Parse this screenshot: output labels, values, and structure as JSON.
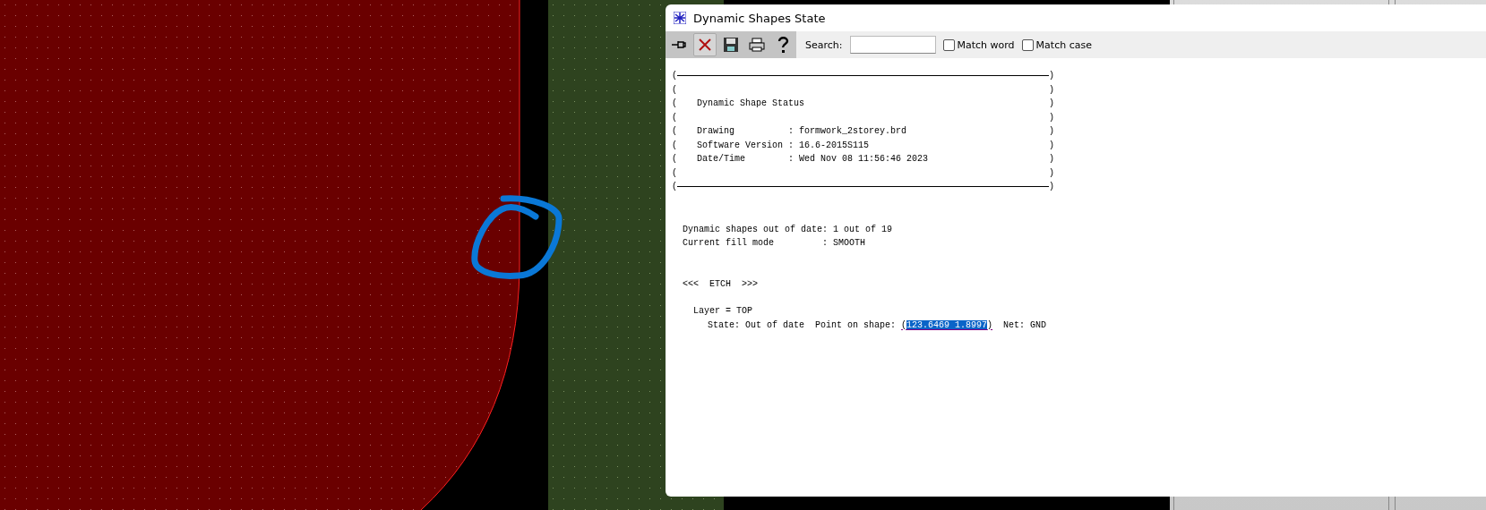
{
  "window": {
    "title": "Dynamic Shapes State"
  },
  "toolbar": {
    "search_label": "Search:",
    "options": [
      {
        "label": "Match word",
        "checked": false
      },
      {
        "label": "Match case",
        "checked": false
      }
    ]
  },
  "report": {
    "box": [
      {
        "kind": "rule",
        "left": "(",
        "right": ")"
      },
      {
        "kind": "text",
        "left": "(",
        "right": ")"
      },
      {
        "kind": "text",
        "left": "(",
        "text": "Dynamic Shape Status",
        "right": ")"
      },
      {
        "kind": "text",
        "left": "(",
        "right": ")"
      },
      {
        "kind": "text",
        "left": "(",
        "text": "Drawing          : formwork_2storey.brd",
        "right": ")"
      },
      {
        "kind": "text",
        "left": "(",
        "text": "Software Version : 16.6-2015S115",
        "right": ")"
      },
      {
        "kind": "text",
        "left": "(",
        "text": "Date/Time        : Wed Nov 08 11:56:46 2023",
        "right": ")"
      },
      {
        "kind": "text",
        "left": "(",
        "right": ")"
      },
      {
        "kind": "rule",
        "left": "(",
        "right": ")"
      }
    ],
    "summary": [
      "Dynamic shapes out of date: 1 out of 19",
      "Current fill mode         : SMOOTH"
    ],
    "section": "<<<  ETCH  >>>",
    "layer": "Layer = TOP",
    "state": {
      "prefix": "State: Out of date  Point on shape: ",
      "link": {
        "open": "(",
        "text": "123.6469 1.8997",
        "close": ")",
        "selected": true
      },
      "suffix": "  Net: GND"
    }
  }
}
